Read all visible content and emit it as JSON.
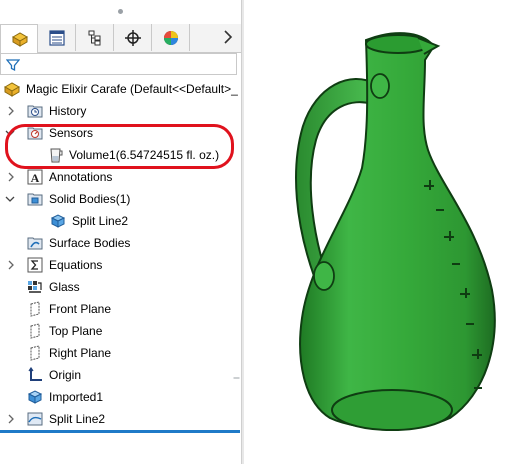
{
  "tabs": [
    {
      "icon": "feature-manager-icon",
      "active": true
    },
    {
      "icon": "property-manager-icon",
      "active": false
    },
    {
      "icon": "configuration-manager-icon",
      "active": false
    },
    {
      "icon": "dimxpert-icon",
      "active": false
    },
    {
      "icon": "display-manager-icon",
      "active": false
    }
  ],
  "filter_icon": "filter-icon",
  "tree": {
    "root": "Magic Elixir Carafe  (Default<<Default>_",
    "history": "History",
    "sensors": "Sensors",
    "volume": "Volume1(6.54724515 fl. oz.)",
    "annotations": "Annotations",
    "solid_bodies": "Solid Bodies(1)",
    "split_line_body": "Split Line2",
    "surface_bodies": "Surface Bodies",
    "equations": "Equations",
    "material": "Glass",
    "front_plane": "Front Plane",
    "top_plane": "Top Plane",
    "right_plane": "Right Plane",
    "origin": "Origin",
    "imported": "Imported1",
    "split_line_feature": "Split Line2"
  },
  "colors": {
    "model_green": "#35a93a",
    "highlight_red": "#e0121d",
    "selection_blue": "#1f7ac8"
  }
}
